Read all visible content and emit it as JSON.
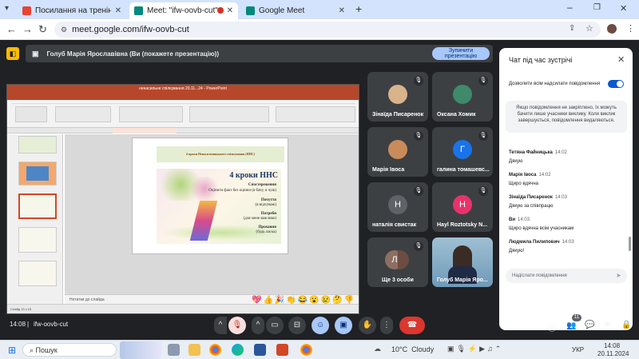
{
  "browser": {
    "tabs": [
      {
        "title": "Посилання на тренінг - m.gc"
      },
      {
        "title": "Meet: \"ifw-oovb-cut\""
      },
      {
        "title": "Google Meet"
      }
    ],
    "new_tab_label": "+",
    "url": "meet.google.com/ifw-oovb-cut"
  },
  "meet": {
    "presenting_text": "Голуб Марія Ярославівна (Ви (покажете презентацію))",
    "stop_button": {
      "line1": "Зупинити",
      "line2": "презентацію"
    },
    "meeting_code": "ifw-oovb-cut",
    "time": "14:08",
    "separator": "|",
    "participants_count": "11",
    "participants": [
      {
        "name": "Зінаїда Писаренок",
        "initial": "",
        "color": "#d9b38c"
      },
      {
        "name": "Оксана Хомик",
        "initial": "",
        "color": "#3e8a6a"
      },
      {
        "name": "Марія Івоса",
        "initial": "",
        "color": "#c98b5a"
      },
      {
        "name": "галина томашевс...",
        "initial": "Г",
        "color": "#1a73e8"
      },
      {
        "name": "наталія свистак",
        "initial": "Н",
        "color": "#5f6368"
      },
      {
        "name": "Hayl Roztotsky N...",
        "initial": "Н",
        "color": "#e8336a"
      },
      {
        "name": "Ще 3 особи",
        "initial": "Л",
        "color": "#8d6e63"
      },
      {
        "name": "Голуб Марія Яро...",
        "initial": "",
        "color": "#8fb3c9"
      }
    ],
    "reactions": [
      "💖",
      "👍",
      "🎉",
      "👏",
      "😂",
      "😮",
      "😢",
      "🤔",
      "👎"
    ]
  },
  "chat": {
    "title": "Чат під час зустрічі",
    "allow_label": "Дозволити всім надсилати повідомлення",
    "notice": "Якщо повідомлення не закріплено, їх можуть бачити лише учасники виклику. Коли виклик завершується, повідомлення видаляються.",
    "messages": [
      {
        "author": "Тетяна Файницька",
        "time": "14:02",
        "text": "Дякую"
      },
      {
        "author": "Марія Івоса",
        "time": "14:02",
        "text": "Щиро вдячна"
      },
      {
        "author": "Зінаїда Писаренок",
        "time": "14:03",
        "text": "Дякую за співпрацю"
      },
      {
        "author": "Ви",
        "time": "14:03",
        "text": "Щиро вдячна всім учасникам"
      },
      {
        "author": "Людмила Пилипович",
        "time": "14:03",
        "text": "Дякую!"
      }
    ],
    "input_placeholder": "Надіслати повідомлення"
  },
  "slide": {
    "title_bar": "4 кроки Ненасильницького спілкування (ННС)",
    "heading": "4 кроки ННС",
    "steps": [
      "Спостереження",
      "Оцінити факт без оцінки (я бачу, я чую)",
      "Почуття",
      "(я відчуваю)",
      "Потреби",
      "(для мене важливо)",
      "Прохання",
      "(будь ласка)"
    ],
    "notes": "Нотатки до слайда",
    "status": "Слайд 13 з 15",
    "ppt_title": "ненасильне спілкування 20.11...24 - PowerPoint"
  },
  "taskbar": {
    "search_label": "Пошук",
    "weather": "10°C  Cloudy",
    "language": "УКР",
    "clock_time": "14:08",
    "clock_date": "20.11.2024"
  }
}
